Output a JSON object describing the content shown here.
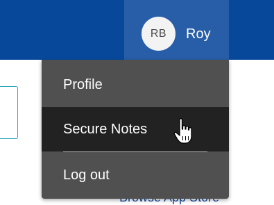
{
  "header": {
    "user": {
      "initials": "RB",
      "name": "Roy"
    }
  },
  "background": {
    "store_link": "Browse App Store"
  },
  "menu": {
    "items": [
      {
        "label": "Profile"
      },
      {
        "label": "Secure Notes",
        "hovered": true
      },
      {
        "label": "Log out"
      }
    ]
  },
  "colors": {
    "header_bg": "#08489b",
    "user_button_bg": "#285ea8",
    "menu_bg": "#505050",
    "menu_hover_bg": "#222222"
  },
  "cursor": {
    "icon": "hand-pointer-icon"
  }
}
